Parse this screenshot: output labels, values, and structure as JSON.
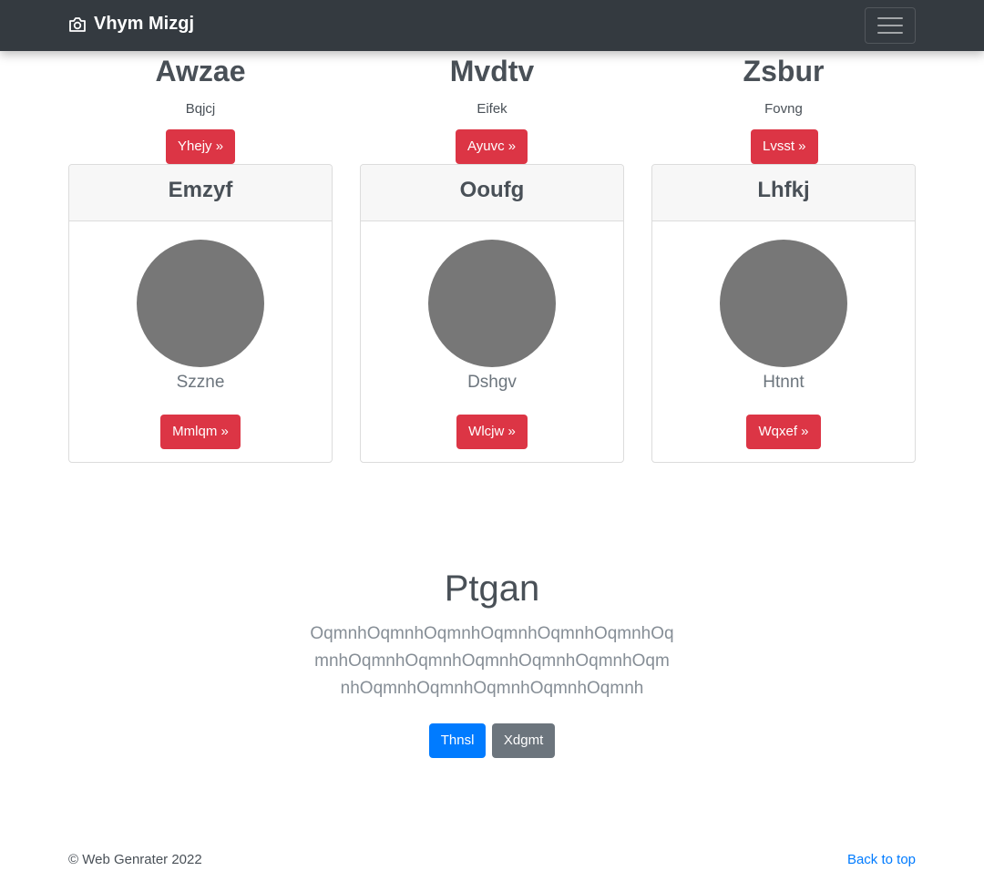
{
  "navbar": {
    "brand": "Vhym Mizgj",
    "brand_icon": "camera-icon",
    "toggler_icon": "hamburger-menu-icon"
  },
  "top_columns": [
    {
      "heading": "Awzae",
      "text": "Bqjcj",
      "button": "Yhejy »"
    },
    {
      "heading": "Mvdtv",
      "text": "Eifek",
      "button": "Ayuvc »"
    },
    {
      "heading": "Zsbur",
      "text": "Fovng",
      "button": "Lvsst »"
    }
  ],
  "cards": [
    {
      "header": "Emzyf",
      "text": "Szzne",
      "button": "Mmlqm »"
    },
    {
      "header": "Ooufg",
      "text": "Dshgv",
      "button": "Wlcjw »"
    },
    {
      "header": "Lhfkj",
      "text": "Htnnt",
      "button": "Wqxef »"
    }
  ],
  "jumbotron": {
    "title": "Ptgan",
    "lead": "OqmnhOqmnhOqmnhOqmnhOqmnhOqmnhOqmnhOqmnhOqmnhOqmnhOqmnhOqmnhOqmnhOqmnhOqmnhOqmnhOqmnhOqmnh",
    "primary_button": "Thnsl",
    "secondary_button": "Xdgmt"
  },
  "footer": {
    "copyright": "© Web Genrater 2022",
    "back_to_top": "Back to top"
  },
  "colors": {
    "navbar_bg": "#343a40",
    "danger": "#dc3545",
    "primary": "#007bff",
    "secondary": "#6c757d",
    "avatar": "#777777"
  }
}
